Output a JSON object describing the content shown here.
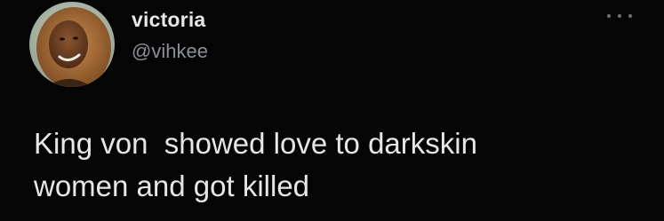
{
  "tweet": {
    "display_name": "victoria",
    "handle": "@vihkee",
    "text_line_1": "King von  showed love to darkskin",
    "text_line_2": "women and got killed"
  },
  "icons": {
    "avatar": "profile-photo",
    "more": "more-horizontal-icon"
  },
  "colors": {
    "background": "#050505",
    "display_name": "#e8e8e8",
    "handle": "#8b9096",
    "text": "#e6e6e6",
    "more_icon": "#6c7176"
  }
}
